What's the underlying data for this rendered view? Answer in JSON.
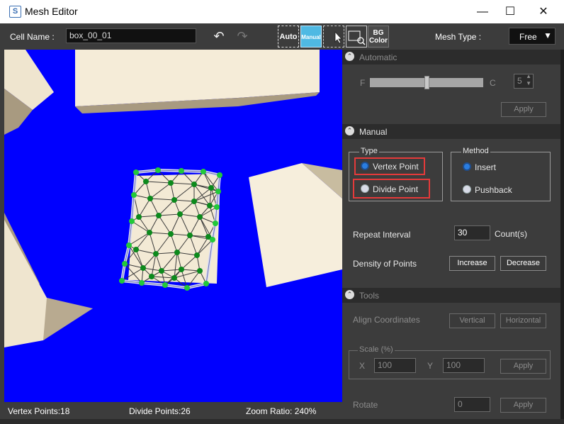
{
  "window": {
    "title": "Mesh Editor",
    "icon_letter": "S",
    "minimize": "—",
    "maximize": "☐",
    "close": "✕"
  },
  "toolbar": {
    "cell_name_label": "Cell Name :",
    "cell_name_value": "box_00_01",
    "undo_icon": "↶",
    "redo_icon": "↷",
    "auto_label": "Auto",
    "manual_label": "Manual",
    "bg_color_line1": "BG",
    "bg_color_line2": "Color",
    "mesh_type_label": "Mesh Type :",
    "mesh_type_value": "Free",
    "mesh_type_arrow": "▼"
  },
  "status": {
    "vertex_points": "Vertex Points:18",
    "divide_points": "Divide Points:26",
    "zoom_ratio": "Zoom Ratio: 240%"
  },
  "panel": {
    "automatic": {
      "title": "Automatic",
      "toggle": "⌃",
      "slider_left": "F",
      "slider_right": "C",
      "slider_level": 0.5,
      "spinner_value": "5",
      "apply": "Apply"
    },
    "manual": {
      "title": "Manual",
      "toggle": "⌃",
      "type_group": "Type",
      "vertex_point": "Vertex Point",
      "divide_point": "Divide Point",
      "method_group": "Method",
      "insert": "Insert",
      "pushback": "Pushback",
      "repeat_interval_label": "Repeat Interval",
      "repeat_interval_value": "30",
      "repeat_interval_unit": "Count(s)",
      "density_label": "Density of Points",
      "increase": "Increase",
      "decrease": "Decrease"
    },
    "tools": {
      "title": "Tools",
      "toggle": "⌃",
      "align_label": "Align Coordinates",
      "vertical": "Vertical",
      "horizontal": "Horizontal",
      "scale_group": "Scale (%)",
      "x_label": "X",
      "x_value": "100",
      "y_label": "Y",
      "y_value": "100",
      "scale_apply": "Apply",
      "rotate_label": "Rotate",
      "rotate_value": "0",
      "rotate_apply": "Apply"
    }
  },
  "colors": {
    "viewport_bg": "#0000ff",
    "mesh_vertex": "#22c93a",
    "mesh_divide": "#0c8a1c",
    "highlight": "#e53a3a",
    "manual_button": "#4fb9e3"
  }
}
